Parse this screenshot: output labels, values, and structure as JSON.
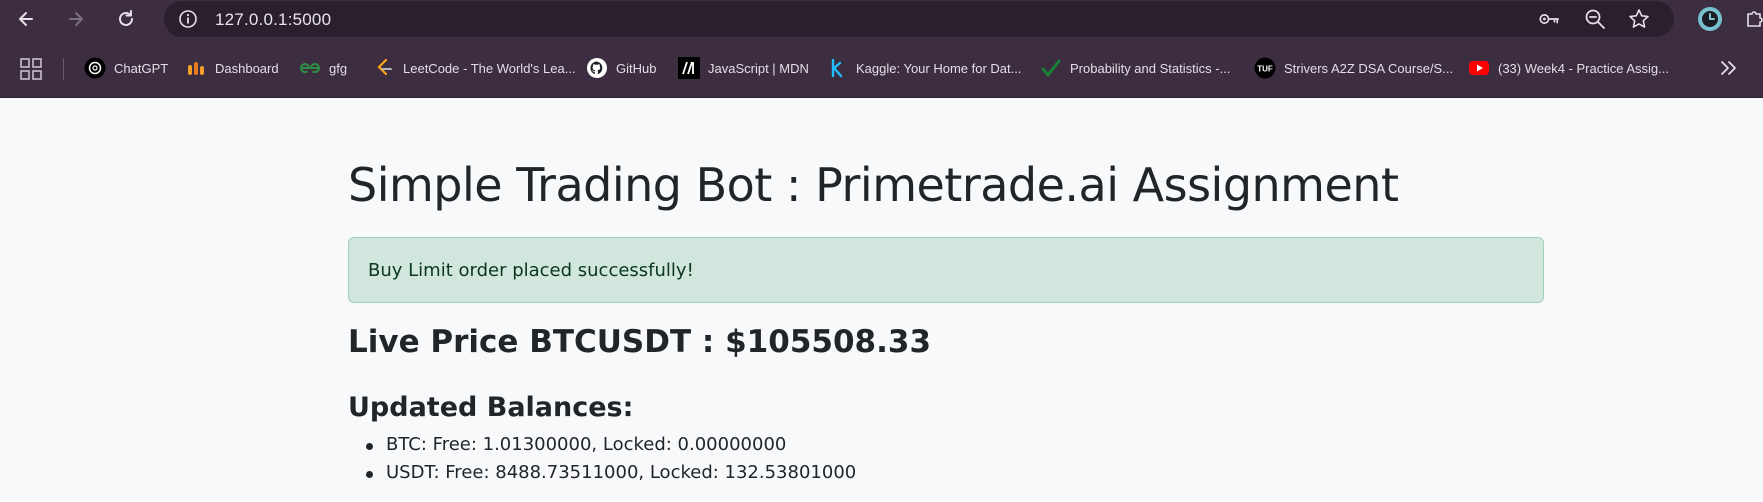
{
  "browser": {
    "url": "127.0.0.1:5000",
    "icons": [
      "back-icon",
      "forward-icon",
      "reload-icon",
      "info-icon",
      "key-icon",
      "zoom-icon",
      "star-icon",
      "profile-icon",
      "extension-icon"
    ],
    "profile_initial": "L"
  },
  "bookmarks": [
    {
      "label": "ChatGPT",
      "icon": "chatgpt-icon"
    },
    {
      "label": "Dashboard",
      "icon": "dashboard-icon"
    },
    {
      "label": "gfg",
      "icon": "gfg-icon"
    },
    {
      "label": "LeetCode - The World's Lea...",
      "icon": "leetcode-icon"
    },
    {
      "label": "GitHub",
      "icon": "github-icon"
    },
    {
      "label": "JavaScript | MDN",
      "icon": "mdn-icon"
    },
    {
      "label": "Kaggle: Your Home for Dat...",
      "icon": "kaggle-icon"
    },
    {
      "label": "Probability and Statistics -...",
      "icon": "check-icon"
    },
    {
      "label": "Strivers A2Z DSA Course/S...",
      "icon": "tuf-icon"
    },
    {
      "label": "(33) Week4 - Practice Assig...",
      "icon": "youtube-icon"
    }
  ],
  "page": {
    "title": "Simple Trading Bot : Primetrade.ai Assignment",
    "alert": "Buy Limit order placed successfully!",
    "live_price": "Live Price BTCUSDT : $105508.33",
    "balances_title": "Updated Balances:",
    "balances": [
      "BTC: Free: 1.01300000, Locked: 0.00000000",
      "USDT: Free: 8488.73511000, Locked: 132.53801000"
    ]
  },
  "colors": {
    "chrome_bg": "#3c2e40",
    "omnibox_bg": "#2a1f2d",
    "page_bg": "#f8f9fa",
    "alert_bg": "#d1e7dd",
    "alert_border": "#a3cfbb",
    "alert_text": "#0a3622"
  }
}
